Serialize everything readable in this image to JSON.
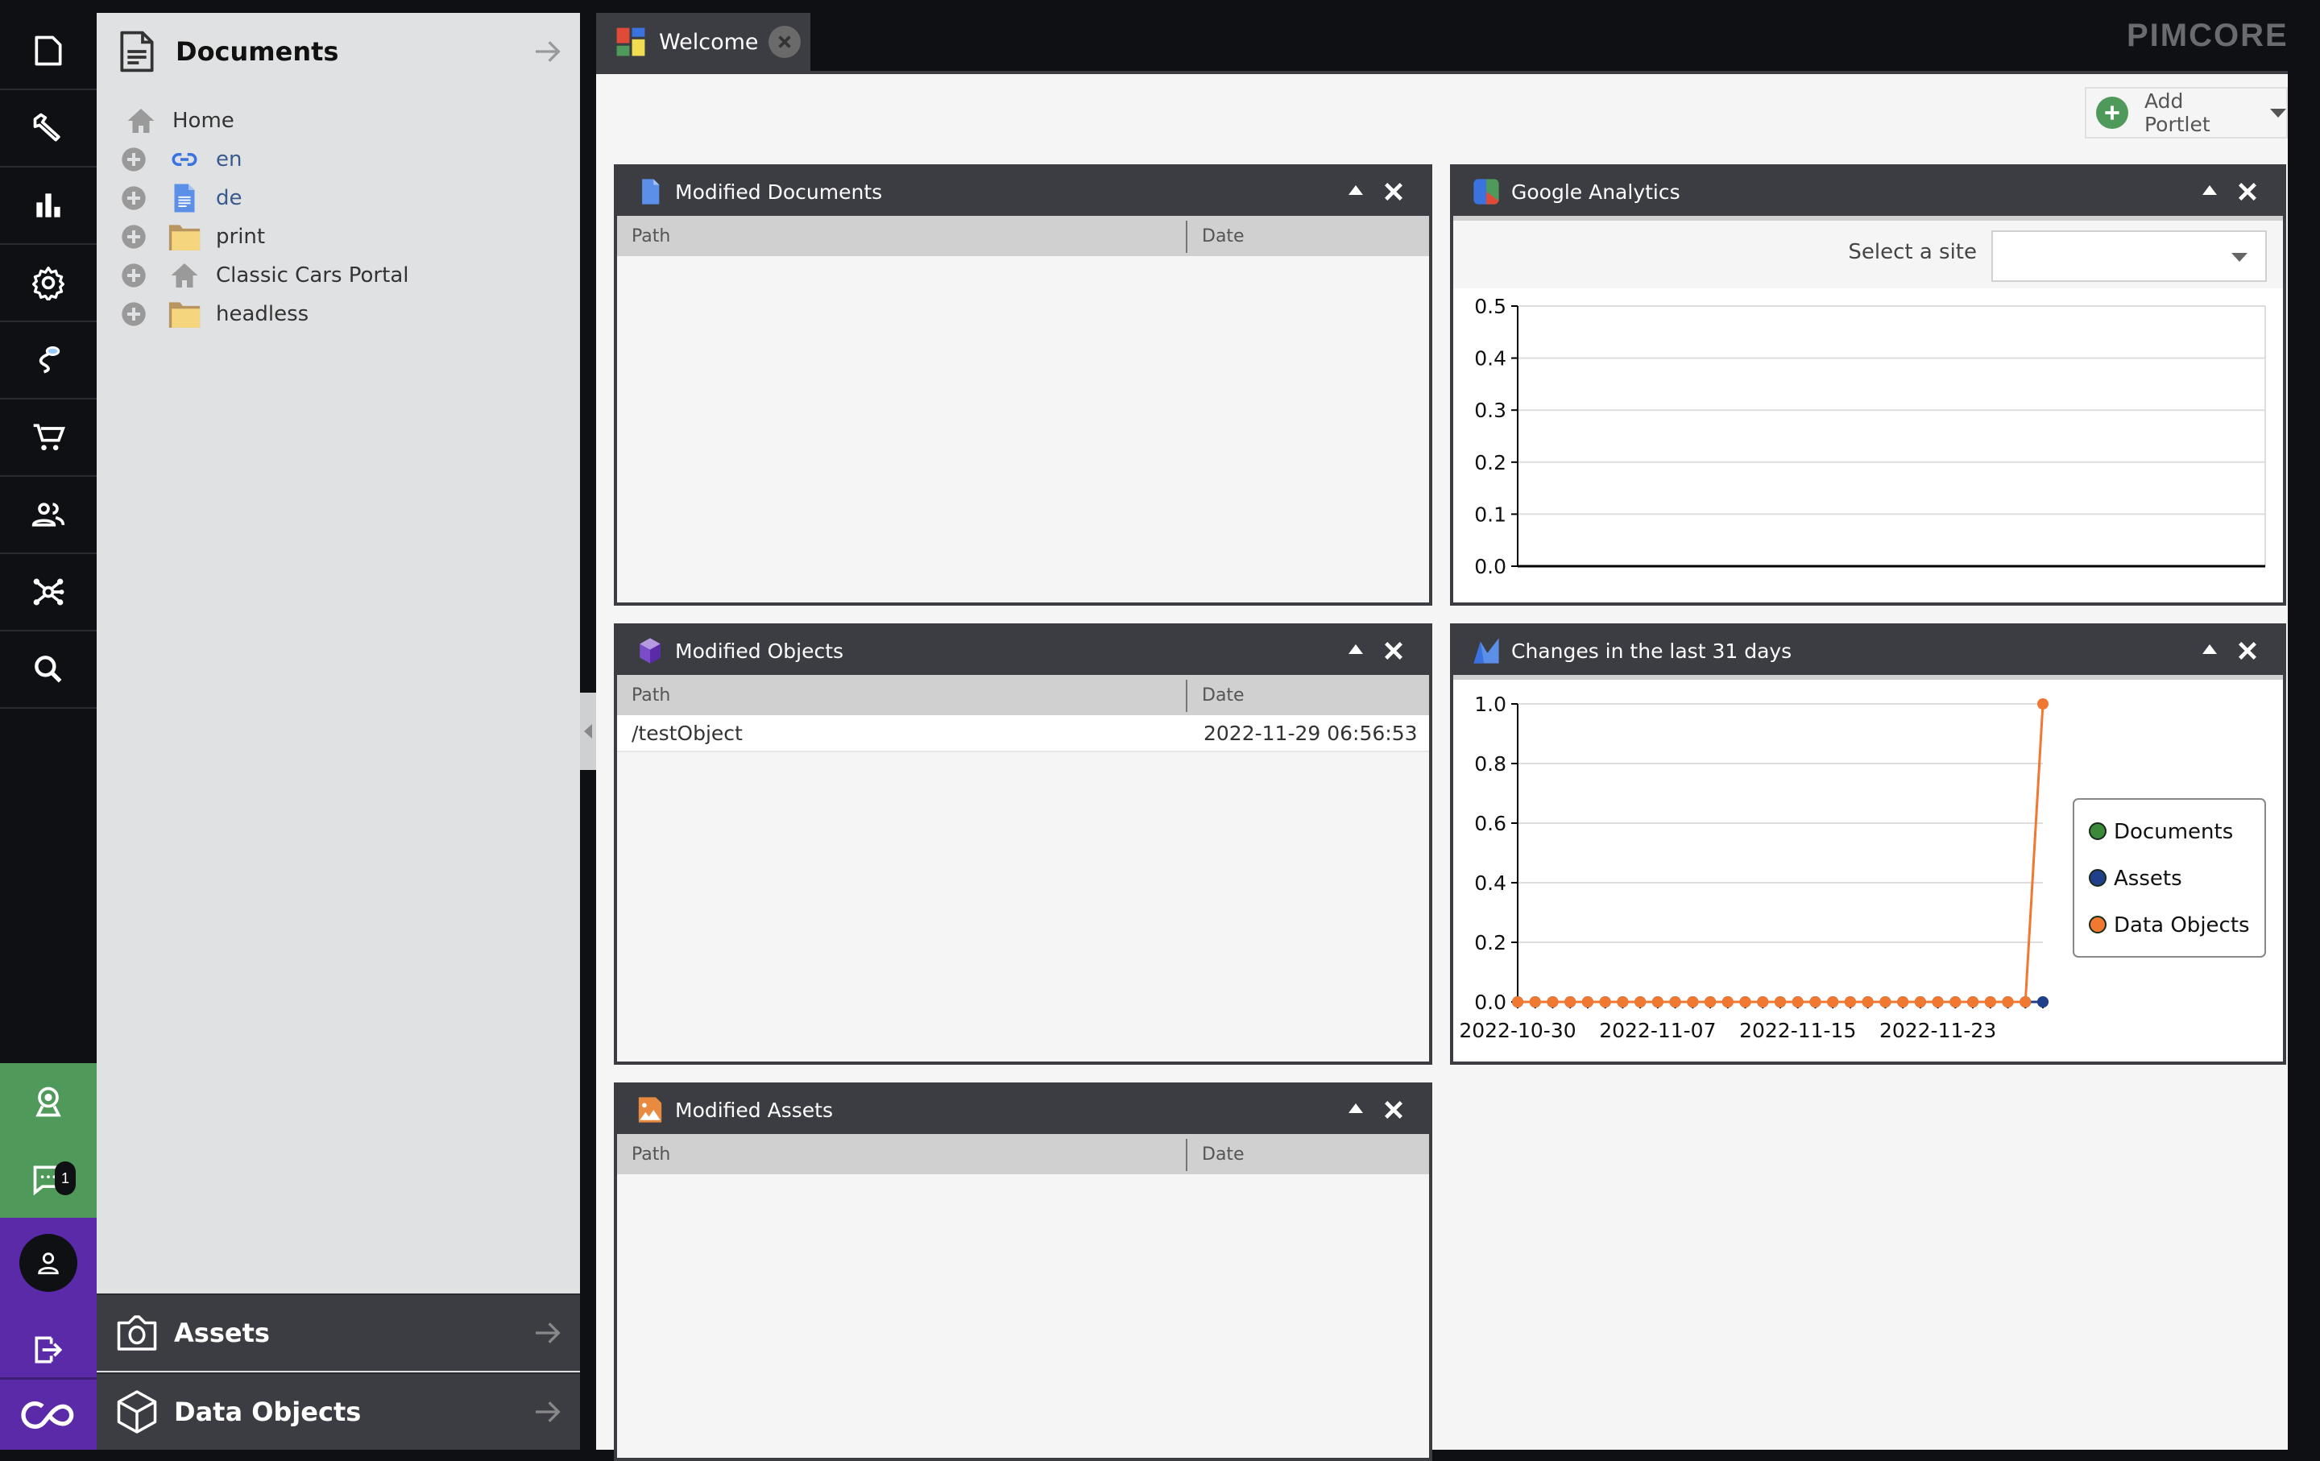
{
  "rail": {
    "items": [
      {
        "name": "documents",
        "icon": "document-icon"
      },
      {
        "name": "tools",
        "icon": "wrench-icon"
      },
      {
        "name": "marketing",
        "icon": "bar-chart-icon"
      },
      {
        "name": "settings",
        "icon": "gear-icon"
      },
      {
        "name": "datahub",
        "icon": "cable-icon"
      },
      {
        "name": "ecommerce",
        "icon": "cart-icon"
      },
      {
        "name": "users",
        "icon": "users-icon"
      },
      {
        "name": "graph",
        "icon": "network-icon"
      },
      {
        "name": "search",
        "icon": "search-icon"
      }
    ],
    "notifications_badge": "1"
  },
  "tree": {
    "title": "Documents",
    "items": [
      {
        "label": "Home",
        "icon": "home-icon",
        "expandable": false
      },
      {
        "label": "en",
        "icon": "link-icon",
        "expandable": true
      },
      {
        "label": "de",
        "icon": "page-icon",
        "expandable": true
      },
      {
        "label": "print",
        "icon": "folder-icon",
        "expandable": true
      },
      {
        "label": "Classic Cars Portal",
        "icon": "home-icon",
        "expandable": true
      },
      {
        "label": "headless",
        "icon": "folder-icon",
        "expandable": true
      }
    ]
  },
  "accordions": {
    "assets": "Assets",
    "data_objects": "Data Objects"
  },
  "tabs": [
    {
      "label": "Welcome"
    }
  ],
  "logo": "PIMCORE",
  "toolbar": {
    "add_portlet": "Add Portlet"
  },
  "portlets": {
    "modified_documents": {
      "title": "Modified Documents",
      "columns": [
        "Path",
        "Date"
      ],
      "rows": []
    },
    "google_analytics": {
      "title": "Google Analytics",
      "select_label": "Select a site",
      "select_value": ""
    },
    "modified_objects": {
      "title": "Modified Objects",
      "columns": [
        "Path",
        "Date"
      ],
      "rows": [
        {
          "path": "/testObject",
          "date": "2022-11-29 06:56:53"
        }
      ]
    },
    "changes": {
      "title": "Changes in the last 31 days"
    },
    "modified_assets": {
      "title": "Modified Assets",
      "columns": [
        "Path",
        "Date"
      ],
      "rows": []
    }
  },
  "chart_data": [
    {
      "type": "line",
      "title": "Google Analytics",
      "series": [],
      "ylim": [
        0,
        0.5
      ],
      "yticks": [
        "0.0",
        "0.1",
        "0.2",
        "0.3",
        "0.4",
        "0.5"
      ],
      "grid": true
    },
    {
      "type": "line",
      "title": "Changes in the last 31 days",
      "x": [
        "2022-10-30",
        "2022-10-31",
        "2022-11-01",
        "2022-11-02",
        "2022-11-03",
        "2022-11-04",
        "2022-11-05",
        "2022-11-06",
        "2022-11-07",
        "2022-11-08",
        "2022-11-09",
        "2022-11-10",
        "2022-11-11",
        "2022-11-12",
        "2022-11-13",
        "2022-11-14",
        "2022-11-15",
        "2022-11-16",
        "2022-11-17",
        "2022-11-18",
        "2022-11-19",
        "2022-11-20",
        "2022-11-21",
        "2022-11-22",
        "2022-11-23",
        "2022-11-24",
        "2022-11-25",
        "2022-11-26",
        "2022-11-27",
        "2022-11-28",
        "2022-11-29"
      ],
      "xticks": [
        "2022-10-30",
        "2022-11-07",
        "2022-11-15",
        "2022-11-23"
      ],
      "yticks": [
        "0.0",
        "0.2",
        "0.4",
        "0.6",
        "0.8",
        "1.0"
      ],
      "ylim": [
        0,
        1.0
      ],
      "grid": true,
      "legend": "right",
      "series": [
        {
          "name": "Documents",
          "color": "#3a8a3a",
          "values": [
            0,
            0,
            0,
            0,
            0,
            0,
            0,
            0,
            0,
            0,
            0,
            0,
            0,
            0,
            0,
            0,
            0,
            0,
            0,
            0,
            0,
            0,
            0,
            0,
            0,
            0,
            0,
            0,
            0,
            0,
            0
          ]
        },
        {
          "name": "Assets",
          "color": "#1f3f8a",
          "values": [
            0,
            0,
            0,
            0,
            0,
            0,
            0,
            0,
            0,
            0,
            0,
            0,
            0,
            0,
            0,
            0,
            0,
            0,
            0,
            0,
            0,
            0,
            0,
            0,
            0,
            0,
            0,
            0,
            0,
            0,
            0
          ]
        },
        {
          "name": "Data Objects",
          "color": "#f07830",
          "values": [
            0,
            0,
            0,
            0,
            0,
            0,
            0,
            0,
            0,
            0,
            0,
            0,
            0,
            0,
            0,
            0,
            0,
            0,
            0,
            0,
            0,
            0,
            0,
            0,
            0,
            0,
            0,
            0,
            0,
            0,
            1
          ]
        }
      ]
    }
  ]
}
